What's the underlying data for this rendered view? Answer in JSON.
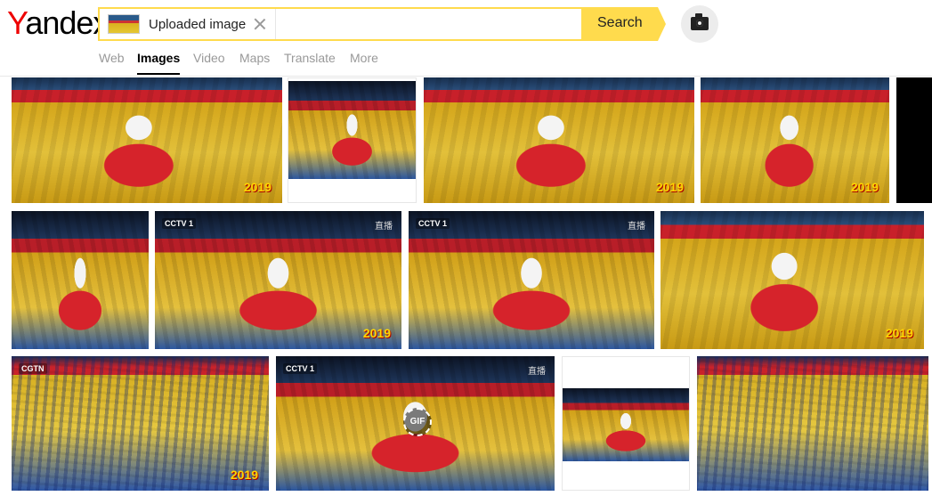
{
  "header": {
    "logo": {
      "first_letter": "Y",
      "rest": "andex"
    },
    "search": {
      "query_label": "Uploaded image",
      "button_label": "Search"
    },
    "tabs": [
      {
        "label": "Web"
      },
      {
        "label": "Images",
        "active": true
      },
      {
        "label": "Video"
      },
      {
        "label": "Maps"
      },
      {
        "label": "Translate"
      },
      {
        "label": "More"
      }
    ]
  },
  "results": {
    "rows": [
      {
        "tiles": [
          {
            "badge": "2019"
          },
          {
            "badge": ""
          },
          {
            "badge": "2019"
          },
          {
            "badge": "2019"
          },
          {
            "badge": ""
          }
        ]
      },
      {
        "tiles": [
          {
            "badge": ""
          },
          {
            "channel": "CCTV 1",
            "live": "直播",
            "badge": "2019"
          },
          {
            "channel": "CCTV 1",
            "live": "直播",
            "badge": ""
          },
          {
            "badge": "2019"
          }
        ]
      },
      {
        "tiles": [
          {
            "channel": "CGTN",
            "badge": "2019"
          },
          {
            "channel": "CCTV 1",
            "live": "直播",
            "gif": "GIF"
          },
          {
            "badge": ""
          },
          {
            "badge": ""
          }
        ]
      }
    ]
  },
  "colors": {
    "accent": "#ffdb4d",
    "logo_red": "#e00"
  }
}
